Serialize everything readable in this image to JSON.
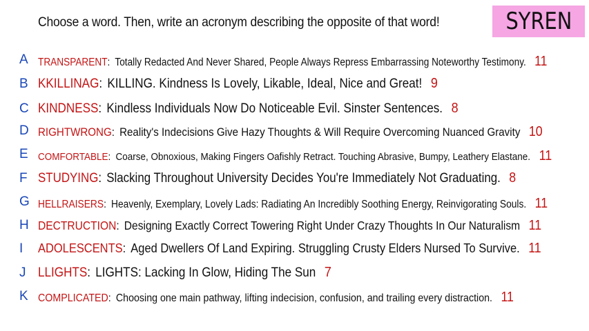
{
  "prompt": "Choose a word. Then, write an acronym describing the opposite of that word!",
  "brand": "SYREN",
  "colors": {
    "letter": "#1a47b8",
    "word": "#c41414",
    "count": "#c41414",
    "brand_bg": "#f5a6e3"
  },
  "entries": [
    {
      "letter": "A",
      "word": "TRANSPARENT",
      "definition": "Totally Redacted And Never Shared, People Always Repress Embarrassing Noteworthy Testimony.",
      "count": "11"
    },
    {
      "letter": "B",
      "word": "KKILLINAG",
      "definition": "KILLING. Kindness Is Lovely, Likable, Ideal, Nice and Great!",
      "count": "9"
    },
    {
      "letter": "C",
      "word": "KINDNESS",
      "definition": "Kindless Individuals Now Do Noticeable Evil. Sinster Sentences.",
      "count": "8"
    },
    {
      "letter": "D",
      "word": "RIGHTWRONG",
      "definition": "Reality's Indecisions Give Hazy Thoughts & Will Require Overcoming Nuanced Gravity",
      "count": "10"
    },
    {
      "letter": "E",
      "word": "COMFORTABLE",
      "definition": "Coarse, Obnoxious, Making Fingers Oafishly Retract. Touching Abrasive, Bumpy, Leathery Elastane.",
      "count": "11"
    },
    {
      "letter": "F",
      "word": "STUDYING",
      "definition": "Slacking Throughout University Decides You're Immediately Not Graduating.",
      "count": "8"
    },
    {
      "letter": "G",
      "word": "HELLRAISERS",
      "definition": "Heavenly, Exemplary, Lovely Lads: Radiating An Incredibly Soothing Energy, Reinvigorating Souls.",
      "count": "11"
    },
    {
      "letter": "H",
      "word": "DECTRUCTION",
      "definition": "Designing Exactly Correct Towering Right Under Crazy Thoughts In Our Naturalism",
      "count": "11"
    },
    {
      "letter": "I",
      "word": "ADOLESCENTS",
      "definition": "Aged Dwellers Of Land Expiring. Struggling Crusty Elders Nursed To Survive.",
      "count": "11"
    },
    {
      "letter": "J",
      "word": "LLIGHTS",
      "definition": "LIGHTS: Lacking In Glow, Hiding The Sun",
      "count": "7"
    },
    {
      "letter": "K",
      "word": "COMPLICATED",
      "definition": "Choosing one main pathway, lifting indecision, confusion, and trailing every distraction.",
      "count": "11"
    }
  ]
}
